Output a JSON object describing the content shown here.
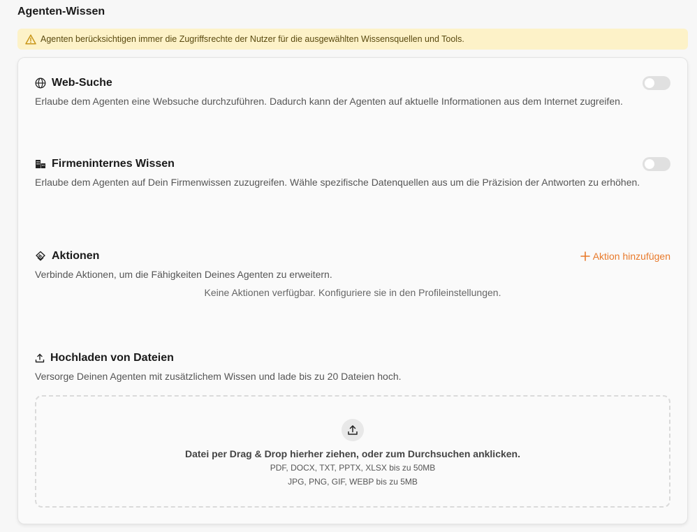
{
  "page": {
    "title": "Agenten-Wissen"
  },
  "banner": {
    "text": "Agenten berücksichtigen immer die Zugriffsrechte der Nutzer für die ausgewählten Wissensquellen und Tools."
  },
  "web_search": {
    "title": "Web-Suche",
    "description": "Erlaube dem Agenten eine Websuche durchzuführen. Dadurch kann der Agenten auf aktuelle Informationen aus dem Internet zugreifen.",
    "enabled": false
  },
  "company_knowledge": {
    "title": "Firmeninternes Wissen",
    "description": "Erlaube dem Agenten auf Dein Firmenwissen zuzugreifen. Wähle spezifische Datenquellen aus um die Präzision der Antworten zu erhöhen.",
    "enabled": false
  },
  "actions": {
    "title": "Aktionen",
    "description": "Verbinde Aktionen, um die Fähigkeiten Deines Agenten zu erweitern.",
    "add_label": "Aktion hinzufügen",
    "empty_text": "Keine Aktionen verfügbar. Konfiguriere sie in den Profileinstellungen."
  },
  "upload": {
    "title": "Hochladen von Dateien",
    "description": "Versorge Deinen Agenten mit zusätzlichem Wissen und lade bis zu 20 Dateien hoch.",
    "drop_text": "Datei per Drag & Drop hierher ziehen, oder zum Durchsuchen anklicken.",
    "formats_docs": "PDF, DOCX, TXT, PPTX, XLSX bis zu 50MB",
    "formats_images": "JPG, PNG, GIF, WEBP bis zu 5MB"
  },
  "colors": {
    "accent": "#e8792a",
    "banner_bg": "#fdf2c8",
    "toggle_off": "#e0e0e0"
  },
  "icons": {
    "banner": "warning-triangle-icon",
    "web_search": "globe-icon",
    "company_knowledge": "buildings-icon",
    "actions": "actions-icon",
    "upload": "upload-icon",
    "add": "plus-icon"
  }
}
